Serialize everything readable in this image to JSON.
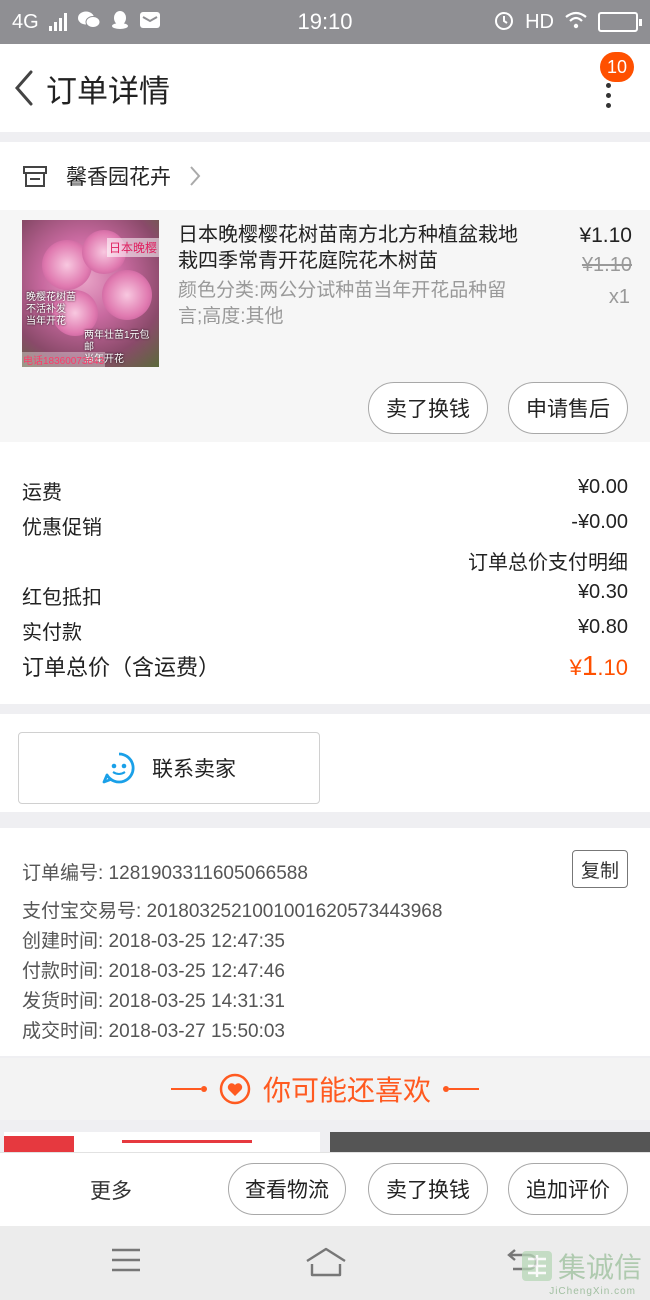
{
  "status_bar": {
    "network": "4G",
    "time": "19:10",
    "hd": "HD"
  },
  "header": {
    "title": "订单详情",
    "badge_count": "10"
  },
  "shop": {
    "name": "馨香园花卉"
  },
  "product": {
    "title": "日本晚樱樱花树苗南方北方种植盆栽地栽四季常青开花庭院花木树苗",
    "spec": "颜色分类:两公分试种苗当年开花品种留言;高度:其他",
    "price": "¥1.10",
    "original_price": "¥1.10",
    "quantity": "x1",
    "image_tag": "日本晚樱",
    "image_caption1": "晚樱花树苗\n不活补发\n当年开花",
    "image_caption2": "两年壮苗1元包邮\n当年开花",
    "image_phone": "电话18360073843",
    "buttons": {
      "sell": "卖了换钱",
      "after_sale": "申请售后"
    }
  },
  "costs": {
    "shipping_label": "运费",
    "shipping_value": "¥0.00",
    "promo_label": "优惠促销",
    "promo_value": "-¥0.00",
    "detail_link": "订单总价支付明细",
    "redpacket_label": "红包抵扣",
    "redpacket_value": "¥0.30",
    "paid_label": "实付款",
    "paid_value": "¥0.80",
    "total_label": "订单总价（含运费）",
    "total_currency": "¥",
    "total_int": "1",
    "total_dec": ".10"
  },
  "contact": {
    "label": "联系卖家"
  },
  "order_info": {
    "order_no": "订单编号: 1281903311605066588",
    "alipay_no": "支付宝交易号: 2018032521001001620573443968",
    "created": "创建时间: 2018-03-25 12:47:35",
    "paid": "付款时间: 2018-03-25 12:47:46",
    "shipped": "发货时间: 2018-03-25 14:31:31",
    "completed": "成交时间: 2018-03-27 15:50:03",
    "copy": "复制"
  },
  "recommend": {
    "title": "你可能还喜欢"
  },
  "action_bar": {
    "more": "更多",
    "logistics": "查看物流",
    "sell": "卖了换钱",
    "review": "追加评价"
  },
  "watermark": {
    "text": "集诚信",
    "sub": "JiChengXin.com"
  },
  "colors": {
    "accent": "#ff5000",
    "status_bar": "#8f8f93",
    "contact_icon": "#1aa0e8"
  }
}
